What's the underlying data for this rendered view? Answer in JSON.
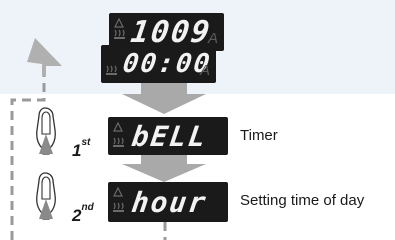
{
  "displays": {
    "clock": {
      "segments": "1009",
      "indicator": "A"
    },
    "clock_prev": {
      "segments": "00:00",
      "indicator": "A"
    },
    "timer": {
      "segments": "bELL"
    },
    "time_of_day": {
      "segments": "hour"
    }
  },
  "steps": [
    {
      "number": "1",
      "suffix": "st",
      "label": "Timer"
    },
    {
      "number": "2",
      "suffix": "nd",
      "label": "Setting time of day"
    }
  ],
  "icons": {
    "alarm": "bell-icon",
    "heat": "heat-wave-icon",
    "press": "finger-press-icon",
    "flow": "down-arrow-icon",
    "loop": "loop-back-arrow-icon"
  },
  "colors": {
    "band": "#edf3f8",
    "display": "#1a1a1a",
    "segment": "#f2f2f2",
    "arrow": "#a9a9a9"
  }
}
